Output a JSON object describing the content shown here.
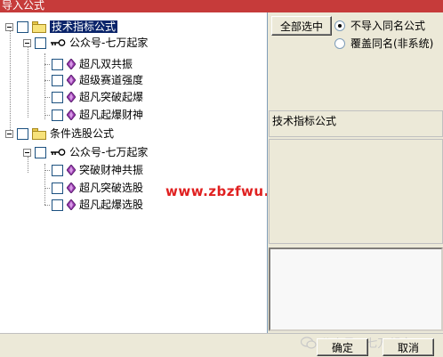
{
  "window": {
    "title": "导入公式"
  },
  "tree": {
    "groups": [
      {
        "label": "技术指标公式",
        "subgroup": "公众号-七万起家",
        "items": [
          "超凡双共振",
          "超级赛道强度",
          "超凡突破起爆",
          "超凡起爆财神"
        ]
      },
      {
        "label": "条件选股公式",
        "subgroup": "公众号-七万起家",
        "items": [
          "突破财神共振",
          "超凡突破选股",
          "超凡起爆选股"
        ]
      }
    ]
  },
  "overlay": {
    "url_watermark": "www.zbzfwu.com",
    "source_watermark": "公众号 · 七万起家"
  },
  "options": {
    "select_all_label": "全部选中",
    "radio_no_import": "不导入同名公式",
    "radio_overwrite": "覆盖同名(非系统)",
    "selected_radio": "no_import"
  },
  "details": {
    "formula_type": "技术指标公式"
  },
  "footer": {
    "ok_label": "确定",
    "cancel_label": "取消"
  },
  "colors": {
    "title_bar": "#c63b3a",
    "selection": "#0a246a",
    "watermark": "#e02020"
  }
}
